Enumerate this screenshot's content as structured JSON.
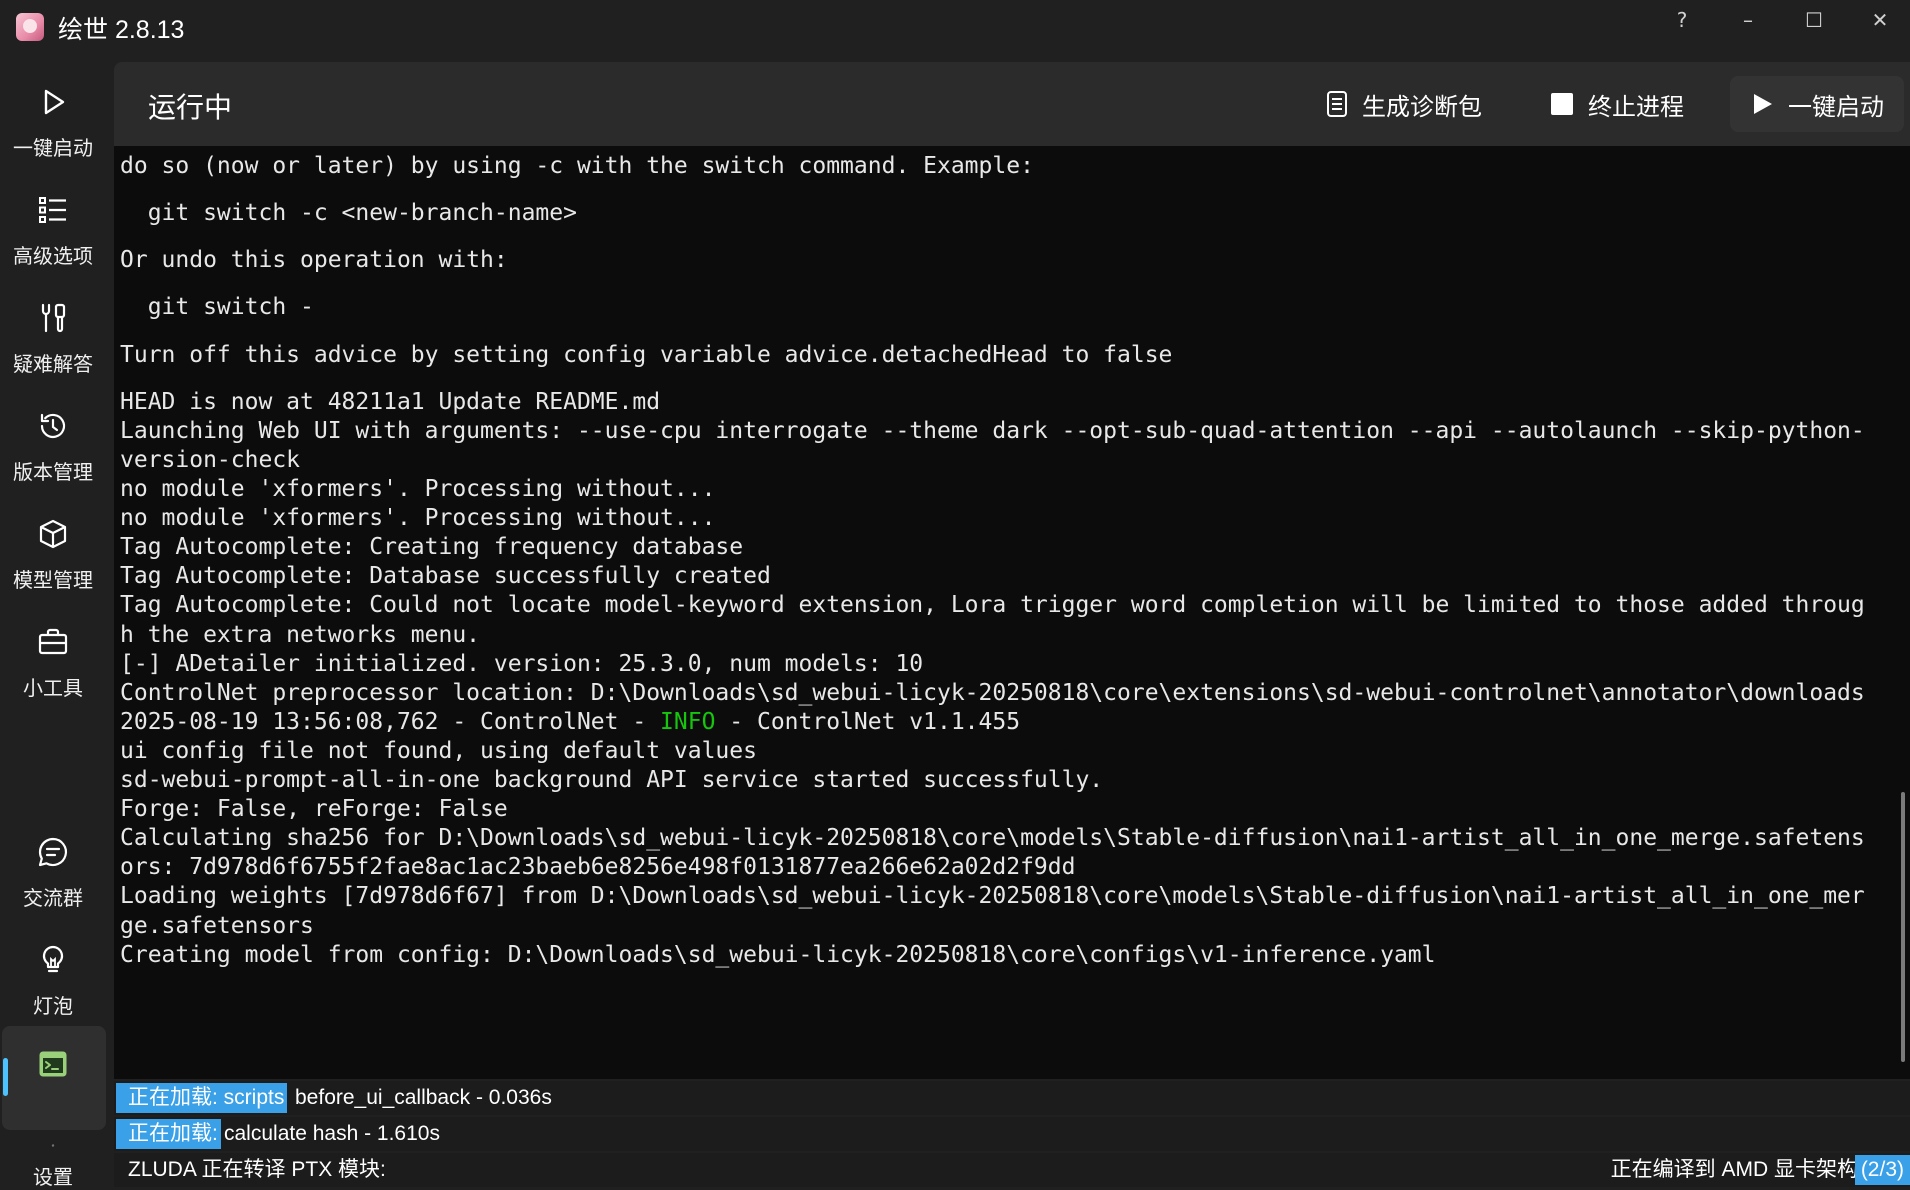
{
  "window": {
    "title": "绘世 2.8.13",
    "controls": {
      "help": "?",
      "minimize": "–",
      "maximize": "☐",
      "close": "✕"
    }
  },
  "sidebar": {
    "items": [
      {
        "id": "launch",
        "label": "一键启动",
        "icon": "play-icon"
      },
      {
        "id": "advanced",
        "label": "高级选项",
        "icon": "list-icon"
      },
      {
        "id": "troubleshoot",
        "label": "疑难解答",
        "icon": "tools-icon"
      },
      {
        "id": "versions",
        "label": "版本管理",
        "icon": "history-icon"
      },
      {
        "id": "models",
        "label": "模型管理",
        "icon": "cube-icon"
      },
      {
        "id": "tools",
        "label": "小工具",
        "icon": "toolbox-icon"
      },
      {
        "id": "community",
        "label": "交流群",
        "icon": "chat-icon"
      },
      {
        "id": "bulb",
        "label": "灯泡",
        "icon": "lightbulb-icon"
      },
      {
        "id": "console",
        "label": "",
        "icon": "console-icon",
        "active": true
      },
      {
        "id": "settings",
        "label": "设置",
        "icon": "gear-icon"
      }
    ]
  },
  "header": {
    "title": "运行中",
    "diagnostics_label": "生成诊断包",
    "stop_label": "终止进程",
    "launch_label": "一键启动"
  },
  "terminal": {
    "lines": [
      "do so (now or later) by using -c with the switch command. Example:",
      "",
      "  git switch -c <new-branch-name>",
      "",
      "Or undo this operation with:",
      "",
      "  git switch -",
      "",
      "Turn off this advice by setting config variable advice.detachedHead to false",
      "",
      "HEAD is now at 48211a1 Update README.md",
      "Launching Web UI with arguments: --use-cpu interrogate --theme dark --opt-sub-quad-attention --api --autolaunch --skip-python-",
      "version-check",
      "no module 'xformers'. Processing without...",
      "no module 'xformers'. Processing without...",
      "Tag Autocomplete: Creating frequency database",
      "Tag Autocomplete: Database successfully created",
      "Tag Autocomplete: Could not locate model-keyword extension, Lora trigger word completion will be limited to those added throug",
      "h the extra networks menu.",
      "[-] ADetailer initialized. version: 25.3.0, num models: 10",
      "ControlNet preprocessor location: D:\\Downloads\\sd_webui-licyk-20250818\\core\\extensions\\sd-webui-controlnet\\annotator\\downloads",
      "__INFO_LINE__",
      "ui config file not found, using default values",
      "sd-webui-prompt-all-in-one background API service started successfully.",
      "Forge: False, reForge: False",
      "Calculating sha256 for D:\\Downloads\\sd_webui-licyk-20250818\\core\\models\\Stable-diffusion\\nai1-artist_all_in_one_merge.safetens",
      "ors: 7d978d6f6755f2fae8ac1ac23baeb6e8256e498f0131877ea266e62a02d2f9dd",
      "Loading weights [7d978d6f67] from D:\\Downloads\\sd_webui-licyk-20250818\\core\\models\\Stable-diffusion\\nai1-artist_all_in_one_mer",
      "ge.safetensors",
      "Creating model from config: D:\\Downloads\\sd_webui-licyk-20250818\\core\\configs\\v1-inference.yaml"
    ],
    "info_line": {
      "prefix": "2025-08-19 13:56:08,762 - ControlNet - ",
      "level": "INFO",
      "suffix": " - ControlNet v1.1.455"
    }
  },
  "status": {
    "line1": {
      "tag": "正在加载: scripts",
      "text": "before_ui_callback - 0.036s"
    },
    "line2": {
      "tag": "正在加载:",
      "text": "calculate hash - 1.610s"
    },
    "line3": {
      "text": "ZLUDA 正在转译 PTX 模块:",
      "right": "正在编译到 AMD 显卡架构",
      "progress": "(2/3)"
    }
  },
  "colors": {
    "background": "#202020",
    "terminal": "#0c0c0c",
    "accent": "#3aa0e8",
    "info": "#16c60c"
  }
}
